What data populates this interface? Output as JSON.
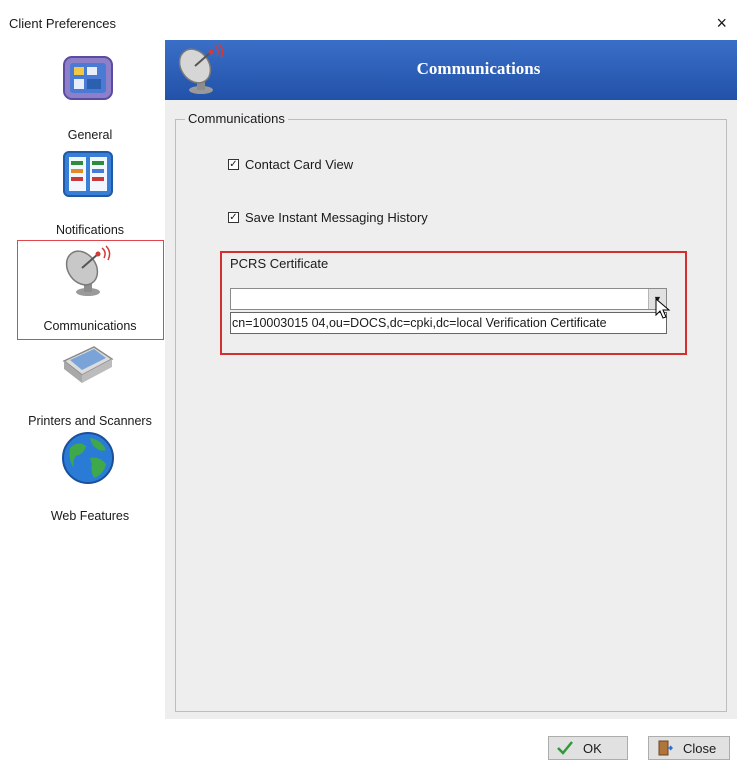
{
  "window": {
    "title": "Client Preferences",
    "close_glyph": "×"
  },
  "sidebar": {
    "items": [
      {
        "label": "General",
        "icon": "general-icon"
      },
      {
        "label": "Notifications",
        "icon": "notifications-icon"
      },
      {
        "label": "Communications",
        "icon": "satellite-dish-icon",
        "selected": true
      },
      {
        "label": "Printers and Scanners",
        "icon": "scanner-icon"
      },
      {
        "label": "Web Features",
        "icon": "globe-icon"
      }
    ]
  },
  "header": {
    "title": "Communications",
    "icon": "satellite-dish-icon",
    "color": "#2a5cb8"
  },
  "group": {
    "legend": "Communications",
    "contact_card_view": {
      "label": "Contact Card View",
      "checked": true
    },
    "save_im_history": {
      "label": "Save Instant Messaging History",
      "checked": true
    },
    "certificate": {
      "label": "PCRS Certificate",
      "selected_value": "",
      "options": [
        "cn=10003015 04,ou=DOCS,dc=cpki,dc=local Verification Certificate"
      ]
    }
  },
  "buttons": {
    "ok": "OK",
    "close": "Close"
  },
  "accent_colors": {
    "highlight": "#d32f2f",
    "selection": "#e0474c"
  }
}
